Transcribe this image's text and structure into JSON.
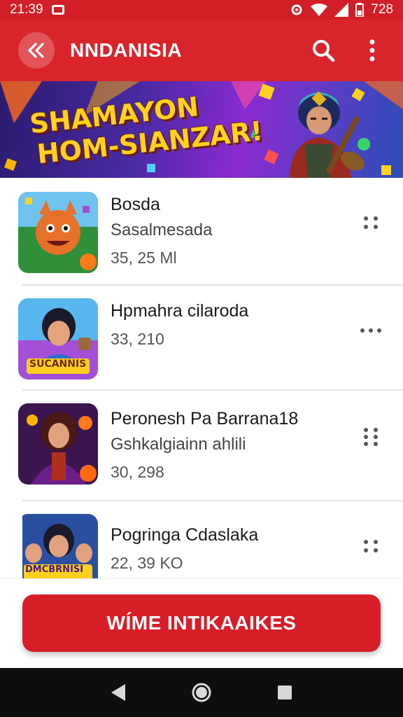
{
  "status_bar": {
    "time": "21:39",
    "right_time": "728"
  },
  "app_bar": {
    "title": "NNDANISIA",
    "back_icon": "back-arrow-icon",
    "search_icon": "search-icon",
    "menu_icon": "overflow-menu-icon"
  },
  "banner": {
    "line1": "SHAMAYON",
    "line2": "HOM-SIANZAR!"
  },
  "items": [
    {
      "title": "Bosda",
      "subtitle": "Sasalmesada",
      "count": "35, 25 Ml",
      "more_icon": "drag-handle-icon"
    },
    {
      "title": "Hpmahra cilaroda",
      "subtitle": "",
      "count": "33, 210",
      "more_icon": "more-horizontal-icon",
      "thumb_label": "SUCANNIS"
    },
    {
      "title": "Peronesh Pa Barrana18",
      "subtitle": "Gshkalgiainn ahlili",
      "count": "30, 298",
      "more_icon": "drag-handle-icon"
    },
    {
      "title": "Pogringa Cdaslaka",
      "subtitle": "",
      "count": "22, 39 KO",
      "more_icon": "drag-handle-icon",
      "thumb_label": "DMCBRNISI"
    }
  ],
  "cta": {
    "label": "WÍME INTIKAAIKES"
  },
  "colors": {
    "primary": "#d9242c",
    "accent_yellow": "#ffd21f"
  }
}
